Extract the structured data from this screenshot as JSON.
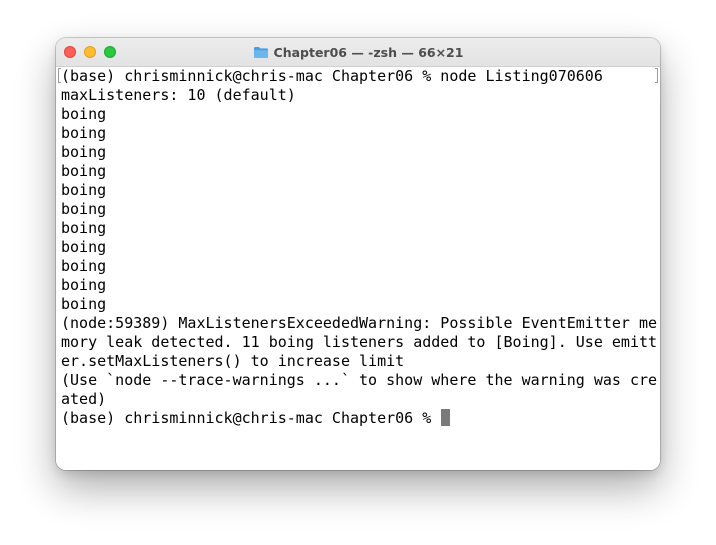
{
  "window": {
    "title": "Chapter06 — -zsh — 66×21",
    "title_icon": "folder-icon",
    "colors": {
      "close": "#ff5f57",
      "minimize": "#febc2e",
      "zoom": "#28c840",
      "folder": "#5aa9e6",
      "cursor": "#7a7a7a"
    }
  },
  "terminal": {
    "lines": [
      "(base) chrisminnick@chris-mac Chapter06 % node Listing070606",
      "maxListeners: 10 (default)",
      "boing",
      "boing",
      "boing",
      "boing",
      "boing",
      "boing",
      "boing",
      "boing",
      "boing",
      "boing",
      "boing",
      "(node:59389) MaxListenersExceededWarning: Possible EventEmitter me",
      "mory leak detected. 11 boing listeners added to [Boing]. Use emitt",
      "er.setMaxListeners() to increase limit",
      "(Use `node --trace-warnings ...` to show where the warning was cre",
      "ated)"
    ],
    "prompt": "(base) chrisminnick@chris-mac Chapter06 % "
  }
}
